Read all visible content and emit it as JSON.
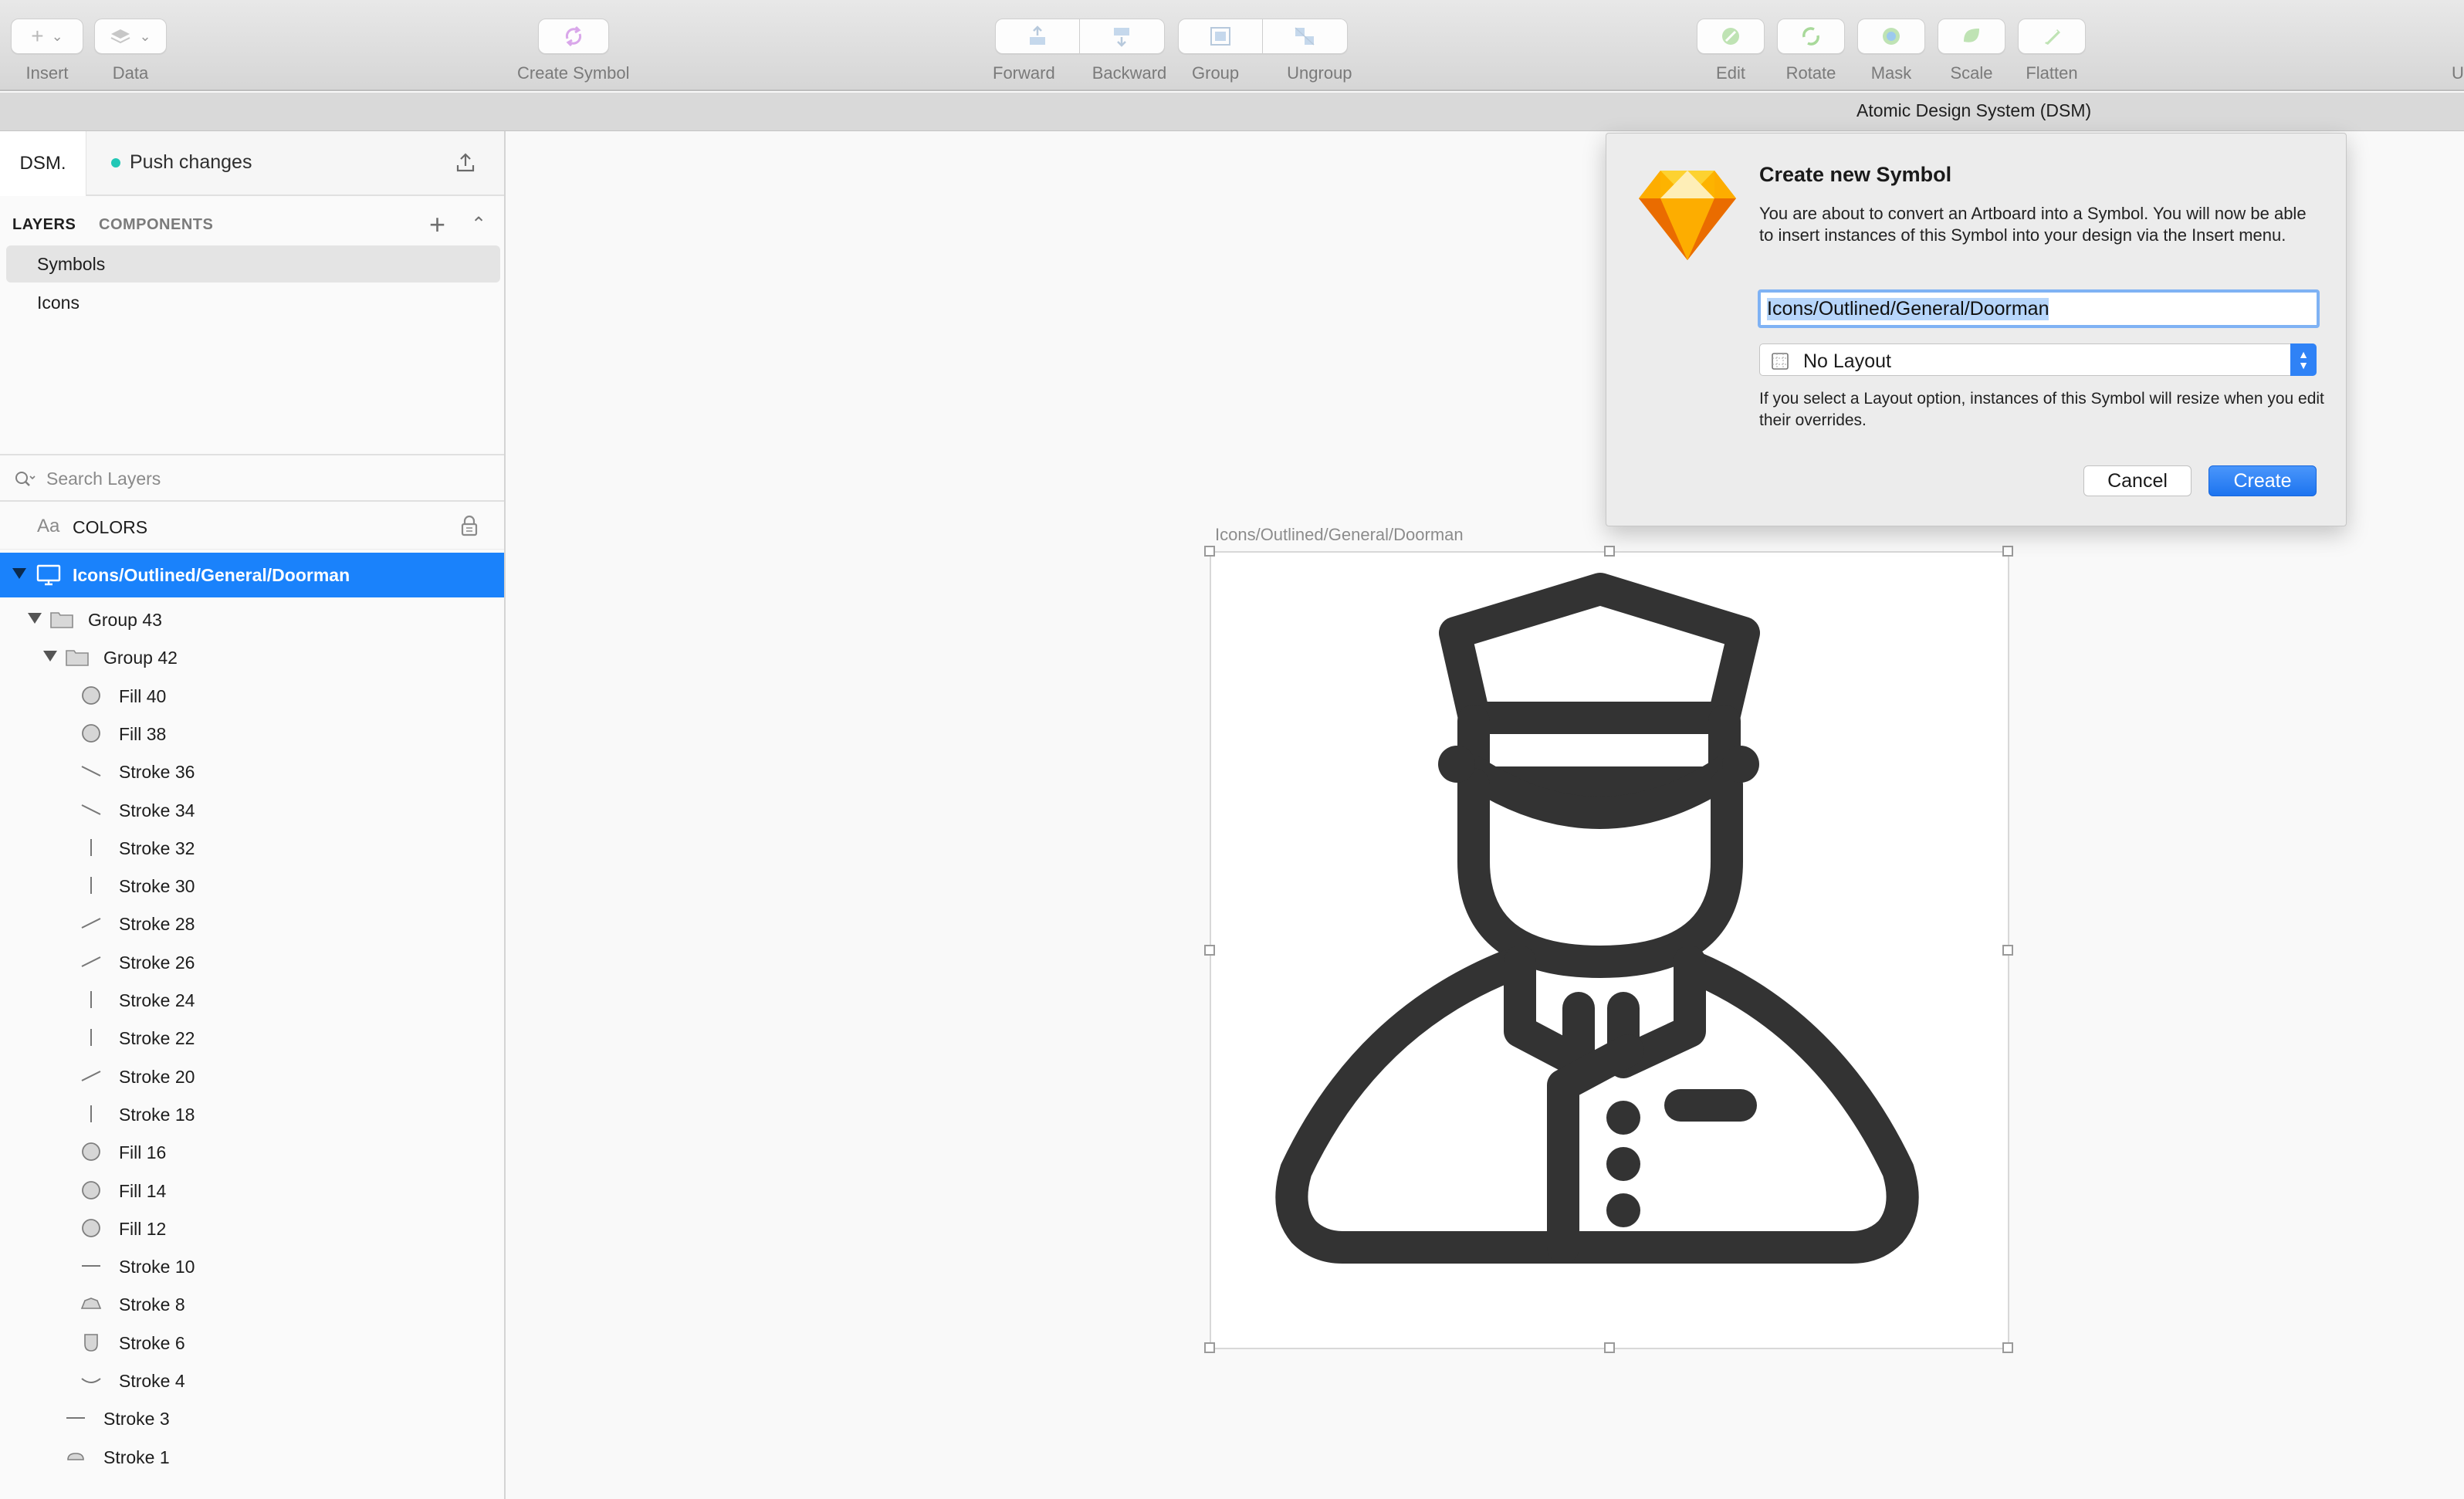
{
  "toolbar": {
    "insert": "Insert",
    "data": "Data",
    "create_symbol": "Create Symbol",
    "forward": "Forward",
    "backward": "Backward",
    "group": "Group",
    "ungroup": "Ungroup",
    "edit": "Edit",
    "rotate": "Rotate",
    "mask": "Mask",
    "scale": "Scale",
    "flatten": "Flatten",
    "cut_off": "U"
  },
  "document_title": "Atomic Design System (DSM)",
  "sidebar": {
    "dsm_tab": "DSM.",
    "push_changes": "Push changes",
    "tabs": {
      "layers": "LAYERS",
      "components": "COMPONENTS"
    },
    "pages": [
      {
        "label": "Symbols",
        "selected": true
      },
      {
        "label": "Icons",
        "selected": false
      }
    ],
    "search_placeholder": "Search Layers",
    "colors_prefix": "Aa",
    "colors_label": "COLORS",
    "root_layer": "Icons/Outlined/General/Doorman",
    "layers": [
      {
        "name": "Group 43",
        "kind": "group"
      },
      {
        "name": "Group 42",
        "kind": "group"
      },
      {
        "name": "Fill 40",
        "kind": "oval"
      },
      {
        "name": "Fill 38",
        "kind": "oval"
      },
      {
        "name": "Stroke 36",
        "kind": "line-diag"
      },
      {
        "name": "Stroke 34",
        "kind": "line-diag"
      },
      {
        "name": "Stroke 32",
        "kind": "line-vert"
      },
      {
        "name": "Stroke 30",
        "kind": "line-vert"
      },
      {
        "name": "Stroke 28",
        "kind": "line-up"
      },
      {
        "name": "Stroke 26",
        "kind": "line-up"
      },
      {
        "name": "Stroke 24",
        "kind": "line-vert"
      },
      {
        "name": "Stroke 22",
        "kind": "line-vert"
      },
      {
        "name": "Stroke 20",
        "kind": "line-up"
      },
      {
        "name": "Stroke 18",
        "kind": "line-vert"
      },
      {
        "name": "Fill 16",
        "kind": "oval"
      },
      {
        "name": "Fill 14",
        "kind": "oval"
      },
      {
        "name": "Fill 12",
        "kind": "oval"
      },
      {
        "name": "Stroke 10",
        "kind": "line-horiz"
      },
      {
        "name": "Stroke 8",
        "kind": "cap"
      },
      {
        "name": "Stroke 6",
        "kind": "shield"
      },
      {
        "name": "Stroke 4",
        "kind": "smile"
      },
      {
        "name": "Stroke 3",
        "kind": "line-horiz"
      },
      {
        "name": "Stroke 1",
        "kind": "pill"
      }
    ]
  },
  "canvas": {
    "artboard_label": "Icons/Outlined/General/Doorman",
    "icon": "doorman-icon"
  },
  "dialog": {
    "title": "Create new Symbol",
    "description": "You are about to convert an Artboard into a Symbol. You will now be able to insert instances of this Symbol into your design via the Insert menu.",
    "name_value": "Icons/Outlined/General/Doorman",
    "layout_selected": "No Layout",
    "hint": "If you select a Layout option, instances of this Symbol will resize when you edit their overrides.",
    "cancel_label": "Cancel",
    "create_label": "Create"
  },
  "colors": {
    "accent": "#1a82fb",
    "push_dot": "#22c7b6",
    "icon_fill": "#333333"
  }
}
